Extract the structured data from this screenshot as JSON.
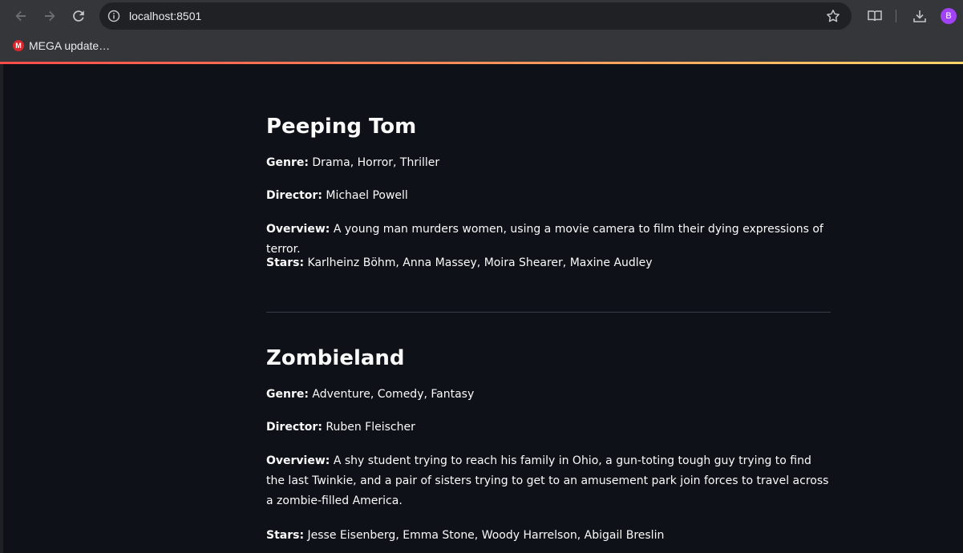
{
  "browser": {
    "url": "localhost:8501",
    "bookmark_label": "MEGA update…",
    "bookmark_icon": "M",
    "avatar_initial": "B"
  },
  "movies": [
    {
      "title": "Peeping Tom",
      "genre_label": "Genre:",
      "genre": "Drama, Horror, Thriller",
      "director_label": "Director:",
      "director": "Michael Powell",
      "overview_label": "Overview:",
      "overview": "A young man murders women, using a movie camera to film their dying expressions of terror.",
      "stars_label": "Stars:",
      "stars": "Karlheinz Böhm, Anna Massey, Moira Shearer, Maxine Audley"
    },
    {
      "title": "Zombieland",
      "genre_label": "Genre:",
      "genre": "Adventure, Comedy, Fantasy",
      "director_label": "Director:",
      "director": "Ruben Fleischer",
      "overview_label": "Overview:",
      "overview": "A shy student trying to reach his family in Ohio, a gun-toting tough guy trying to find the last Twinkie, and a pair of sisters trying to get to an amusement park join forces to travel across a zombie-filled America.",
      "stars_label": "Stars:",
      "stars": "Jesse Eisenberg, Emma Stone, Woody Harrelson, Abigail Breslin"
    }
  ],
  "colors": {
    "page_bg": "#0e1117",
    "text": "#fafafa",
    "chrome_bg": "#35363a",
    "accent": "#ff4b4b"
  }
}
